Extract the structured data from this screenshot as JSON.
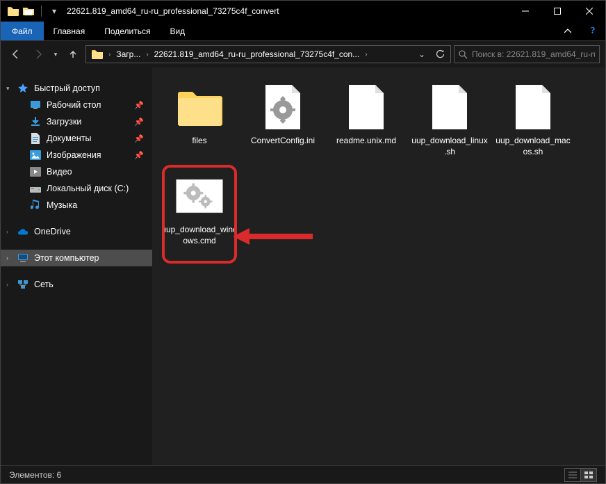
{
  "window": {
    "title": "22621.819_amd64_ru-ru_professional_73275c4f_convert"
  },
  "ribbon": {
    "file": "Файл",
    "tabs": [
      "Главная",
      "Поделиться",
      "Вид"
    ]
  },
  "breadcrumb": {
    "root_icon": "folder",
    "items": [
      "Загр...",
      "22621.819_amd64_ru-ru_professional_73275c4f_con..."
    ]
  },
  "search": {
    "placeholder": "Поиск в: 22621.819_amd64_ru-ru..."
  },
  "sidebar": {
    "quick_access": {
      "label": "Быстрый доступ"
    },
    "items_qa": [
      {
        "label": "Рабочий стол",
        "pinned": true,
        "icon": "desktop"
      },
      {
        "label": "Загрузки",
        "pinned": true,
        "icon": "downloads"
      },
      {
        "label": "Документы",
        "pinned": true,
        "icon": "documents"
      },
      {
        "label": "Изображения",
        "pinned": true,
        "icon": "pictures"
      },
      {
        "label": "Видео",
        "pinned": false,
        "icon": "video"
      },
      {
        "label": "Локальный диск (C:)",
        "pinned": false,
        "icon": "disk"
      },
      {
        "label": "Музыка",
        "pinned": false,
        "icon": "music"
      }
    ],
    "onedrive": {
      "label": "OneDrive"
    },
    "thispc": {
      "label": "Этот компьютер"
    },
    "network": {
      "label": "Сеть"
    }
  },
  "files": [
    {
      "name": "files",
      "type": "folder"
    },
    {
      "name": "ConvertConfig.ini",
      "type": "ini"
    },
    {
      "name": "readme.unix.md",
      "type": "file"
    },
    {
      "name": "uup_download_linux.sh",
      "type": "file"
    },
    {
      "name": "uup_download_macos.sh",
      "type": "file"
    },
    {
      "name": "uup_download_windows.cmd",
      "type": "cmd",
      "highlighted": true
    }
  ],
  "statusbar": {
    "count_label": "Элементов: 6"
  }
}
